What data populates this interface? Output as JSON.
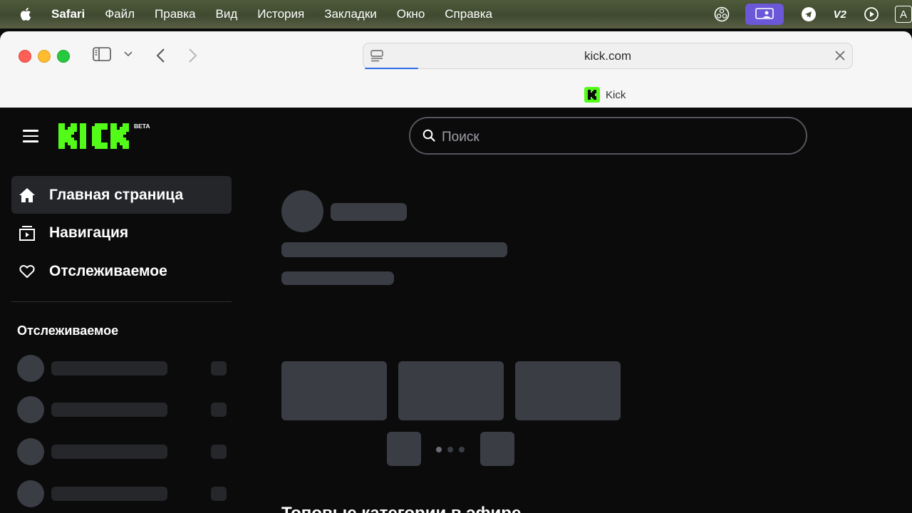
{
  "menubar": {
    "app_name": "Safari",
    "items": [
      "Файл",
      "Правка",
      "Вид",
      "История",
      "Закладки",
      "Окно",
      "Справка"
    ],
    "status_icons": [
      "obs-icon",
      "screen-share-icon",
      "telegram-icon",
      "v2-icon",
      "play-circle-icon",
      "input-source-icon"
    ],
    "v2_label": "V2",
    "input_label": "A"
  },
  "browser": {
    "url": "kick.com",
    "tab_title": "Kick",
    "accent_color": "#2f6ee6"
  },
  "site": {
    "brand_color": "#53fc18",
    "logo_text": "KICK",
    "logo_badge": "BETA",
    "search_placeholder": "Поиск",
    "nav": [
      {
        "label": "Главная страница",
        "icon": "home-icon",
        "active": true
      },
      {
        "label": "Навигация",
        "icon": "browse-icon",
        "active": false
      },
      {
        "label": "Отслеживаемое",
        "icon": "heart-icon",
        "active": false
      }
    ],
    "following_title": "Отслеживаемое",
    "bottom_heading": "Топовые категории в эфире"
  }
}
